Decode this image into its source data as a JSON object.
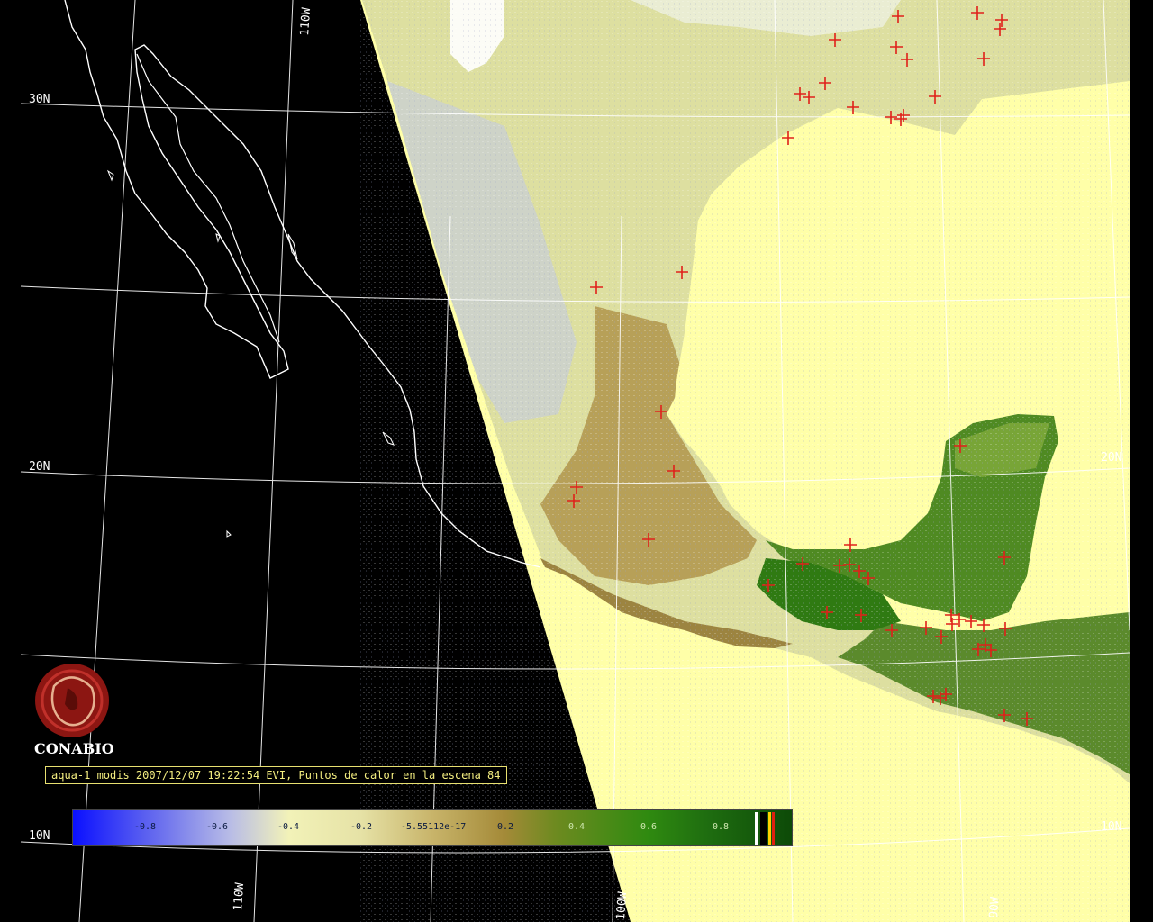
{
  "map": {
    "latitude_labels": [
      "30N",
      "20N",
      "10N"
    ],
    "latitude_labels_right": [
      "20N",
      "10N"
    ],
    "longitude_labels_top": [
      "110W"
    ],
    "longitude_labels_bottom": [
      "110W",
      "100W",
      "90W"
    ],
    "background_color": "#000000",
    "ocean_color": "#ffffa8",
    "coastline_color": "#ffffff",
    "graticule_color": "#ffffff",
    "hotspot_color": "#e0201a",
    "hotspot_icon": "red-cross-marker"
  },
  "logo": {
    "name": "CONABIO",
    "icon": "conabio-logo"
  },
  "caption": {
    "text": "aqua-1 modis 2007/12/07 19:22:54 EVI, Puntos de calor en la escena 84"
  },
  "colorbar": {
    "ticks": [
      "-0.8",
      "-0.6",
      "-0.4",
      "-0.2",
      "-5.55112e-17",
      "0.2",
      "0.4",
      "0.6",
      "0.8"
    ],
    "tick_positions": [
      -0.8,
      -0.6,
      -0.4,
      -0.2,
      0,
      0.2,
      0.4,
      0.6,
      0.8
    ],
    "range": [
      -1.0,
      1.0
    ],
    "extra_colors": [
      "#ffffff",
      "#000000",
      "#ffd000",
      "#e02010"
    ]
  }
}
